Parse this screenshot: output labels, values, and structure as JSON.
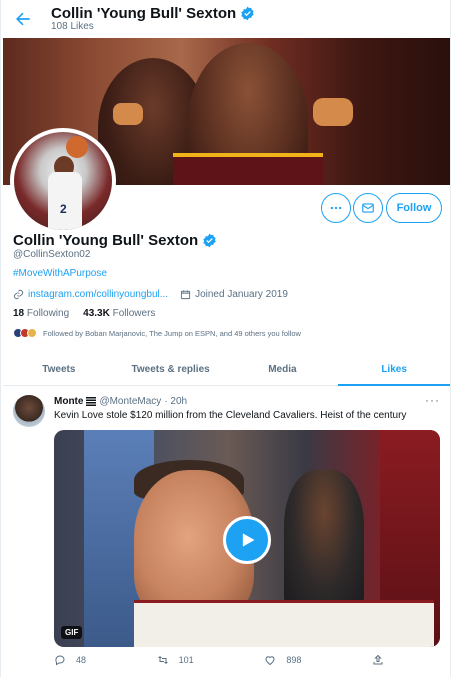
{
  "header": {
    "name": "Collin 'Young Bull' Sexton",
    "likes_count": "108 Likes"
  },
  "actions": {
    "follow_label": "Follow"
  },
  "profile": {
    "name": "Collin 'Young Bull' Sexton",
    "handle": "@CollinSexton02",
    "bio": "#MoveWithAPurpose",
    "link": "instagram.com/collinyoungbul...",
    "joined": "Joined January 2019",
    "following_count": "18",
    "following_label": "Following",
    "followers_count": "43.3K",
    "followers_label": "Followers",
    "followed_by": "Followed by Boban Marjanovic, The Jump on ESPN, and 49 others you follow",
    "avatar_number": "2"
  },
  "tabs": [
    {
      "label": "Tweets"
    },
    {
      "label": "Tweets & replies"
    },
    {
      "label": "Media"
    },
    {
      "label": "Likes"
    }
  ],
  "tweet": {
    "name": "Monte",
    "handle": "@MonteMacy",
    "time": "· 20h",
    "text": "Kevin Love stole $120 million from the Cleveland Cavaliers. Heist of the century",
    "media_badge": "GIF",
    "replies": "48",
    "retweets": "101",
    "likes": "898"
  },
  "colors": {
    "accent": "#1da1f2",
    "muted": "#5b7083",
    "text": "#0f1419"
  }
}
